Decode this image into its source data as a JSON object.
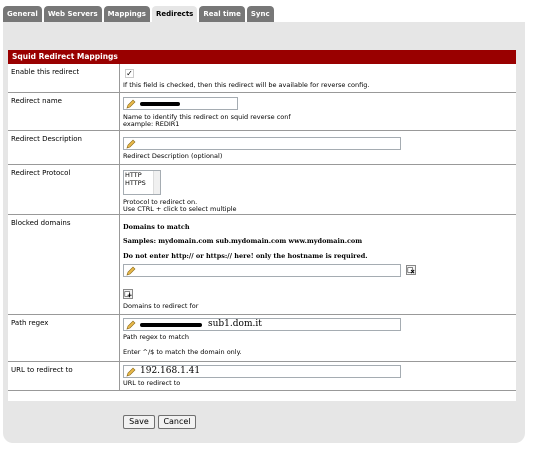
{
  "tabs": [
    {
      "label": "General"
    },
    {
      "label": "Web Servers"
    },
    {
      "label": "Mappings"
    },
    {
      "label": "Redirects"
    },
    {
      "label": "Real time"
    },
    {
      "label": "Sync"
    }
  ],
  "active_tab": "Redirects",
  "section_title": "Squid Redirect Mappings",
  "fields": {
    "enable": {
      "label": "Enable this redirect",
      "checked": true,
      "check_glyph": "✓",
      "description": "If this field is checked, then this redirect will be available for reverse config."
    },
    "name": {
      "label": "Redirect name",
      "value": "",
      "description_line1": "Name to identify this redirect on squid reverse conf",
      "description_line2": "example: REDIR1"
    },
    "description": {
      "label": "Redirect Description",
      "value": "",
      "description": "Redirect Description (optional)"
    },
    "protocol": {
      "label": "Redirect Protocol",
      "options": [
        "HTTP",
        "HTTPS"
      ],
      "description_line1": "Protocol to redirect on.",
      "description_line2": "Use CTRL + click to select multiple"
    },
    "blocked": {
      "label": "Blocked domains",
      "heading": "Domains to match",
      "samples": "Samples: mydomain.com sub.mydomain.com www.mydomain.com",
      "warning": "Do not enter http:// or https:// here! only the hostname is required.",
      "value": "",
      "description": "Domains to redirect for"
    },
    "path_regex": {
      "label": "Path regex",
      "value": "sub1.dom.it",
      "description_line1": "Path regex to match",
      "description_line2": "Enter ^/$ to match the domain only."
    },
    "url": {
      "label": "URL to redirect to",
      "value": "192.168.1.41",
      "description": "URL to redirect to"
    }
  },
  "buttons": {
    "save": "Save",
    "cancel": "Cancel"
  },
  "colors": {
    "header_red": "#990000",
    "tab_gray": "#777777",
    "panel_gray": "#e6e6e6"
  },
  "icons": [
    "pencil-icon",
    "remove-row-icon",
    "add-row-icon",
    "checkmark-icon"
  ]
}
